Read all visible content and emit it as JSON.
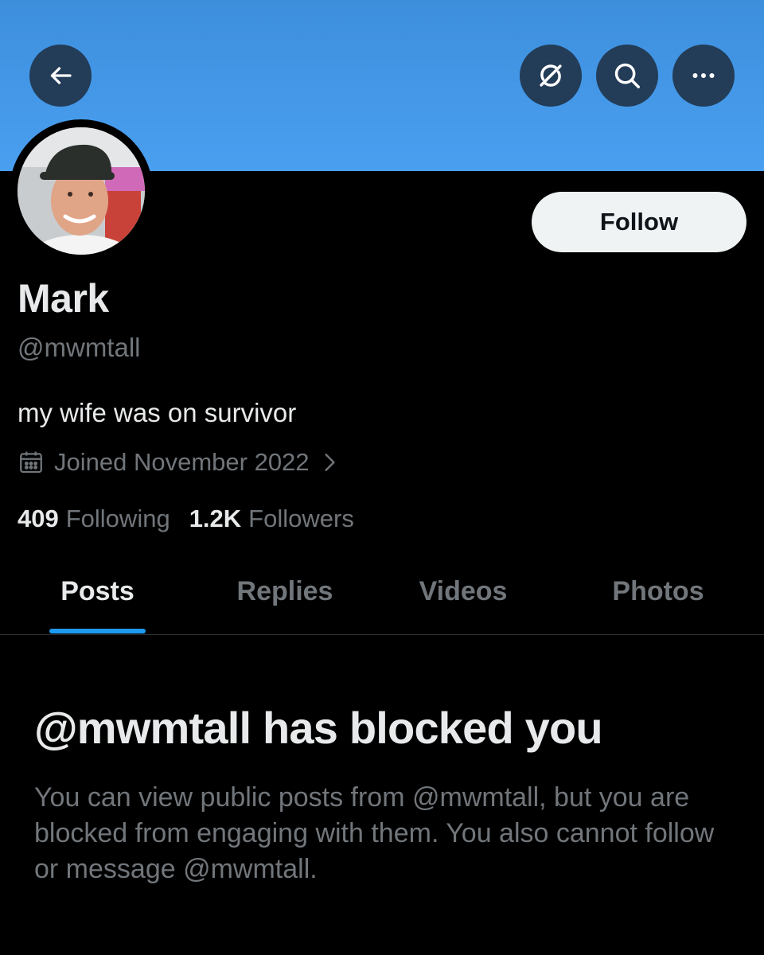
{
  "header": {
    "back_icon": "arrow-left-icon",
    "grok_icon": "slash-circle-icon",
    "search_icon": "search-icon",
    "more_icon": "more-horizontal-icon",
    "banner_color": "#4a9ff0"
  },
  "profile": {
    "avatar_icon": "avatar",
    "display_name": "Mark",
    "handle": "@mwmtall",
    "bio": "my wife was on survivor",
    "joined": "Joined November 2022",
    "follow_label": "Follow",
    "following_count": "409",
    "following_label": "Following",
    "followers_count": "1.2K",
    "followers_label": "Followers"
  },
  "tabs": [
    {
      "label": "Posts",
      "active": true
    },
    {
      "label": "Replies",
      "active": false
    },
    {
      "label": "Videos",
      "active": false
    },
    {
      "label": "Photos",
      "active": false
    }
  ],
  "blocked": {
    "title": "@mwmtall has blocked you",
    "message": "You can view public posts from @mwmtall, but you are blocked from engaging with them. You also cannot follow or message @mwmtall."
  },
  "colors": {
    "accent": "#1d9bf0",
    "secondary_text": "#71767b",
    "primary_text": "#e7e9ea",
    "button_bg": "#233c57"
  }
}
